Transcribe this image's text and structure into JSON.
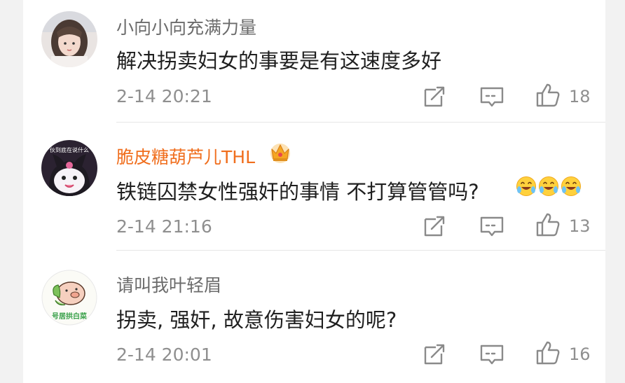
{
  "comments": [
    {
      "username": "小向小向充满力量",
      "text": "解决拐卖妇女的事要是有这速度多好",
      "time": "2-14 20:21",
      "likes": "18",
      "avatar_icon": "girl-photo-avatar"
    },
    {
      "username": "脆皮糖葫芦儿THL",
      "text": "铁链囚禁女性强奸的事情 不打算管管吗?",
      "emoji_count": 3,
      "time": "2-14 21:16",
      "likes": "13",
      "avatar_icon": "kuromi-avatar",
      "avatar_caption": "伙到底在说什么",
      "badge_icon": "crown-icon",
      "name_color": "#f06e1d"
    },
    {
      "username": "请叫我叶轻眉",
      "text": "拐卖, 强奸, 故意伤害妇女的呢?",
      "time": "2-14 20:01",
      "likes": "16",
      "avatar_icon": "pig-cabbage-avatar",
      "avatar_caption": "号居拱白菜"
    }
  ]
}
